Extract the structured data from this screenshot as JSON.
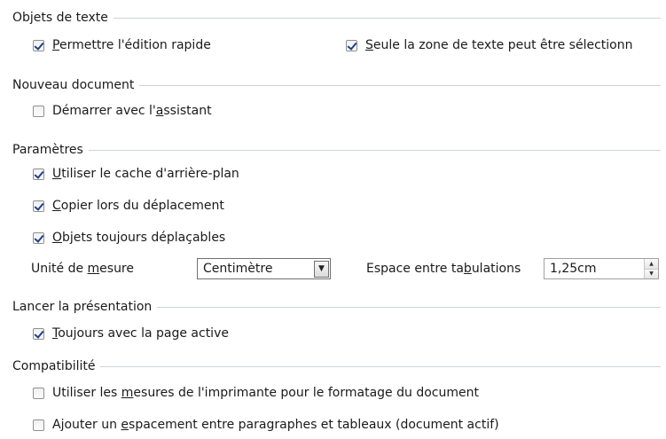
{
  "sections": {
    "text_objects": {
      "title": "Objets de texte",
      "quick_edit": {
        "pre": "",
        "u": "P",
        "post": "ermettre l'édition rapide",
        "checked": true
      },
      "text_area_only": {
        "pre": "",
        "u": "S",
        "post": "eule la zone de texte peut être sélectionn",
        "checked": true
      }
    },
    "new_document": {
      "title": "Nouveau document",
      "start_wizard": {
        "pre": "Démarrer avec l'",
        "u": "a",
        "post": "ssistant",
        "checked": false
      }
    },
    "settings": {
      "title": "Paramètres",
      "bg_cache": {
        "pre": "",
        "u": "U",
        "post": "tiliser le cache d'arrière-plan",
        "checked": true
      },
      "copy_on_move": {
        "pre": "",
        "u": "C",
        "post": "opier lors du déplacement",
        "checked": true
      },
      "objects_movable": {
        "pre": "",
        "u": "O",
        "post": "bjets toujours déplaçables",
        "checked": true
      },
      "unit_label": {
        "pre": "Unité de ",
        "u": "m",
        "post": "esure"
      },
      "unit_value": "Centimètre",
      "tab_label": {
        "pre": "Espace entre ta",
        "u": "b",
        "post": "ulations"
      },
      "tab_value": "1,25cm"
    },
    "presentation": {
      "title": "Lancer la présentation",
      "always_active_page": {
        "pre": "",
        "u": "T",
        "post": "oujours avec la page active",
        "checked": true
      }
    },
    "compat": {
      "title": "Compatibilité",
      "printer_metrics": {
        "pre": "Utiliser les ",
        "u": "m",
        "post": "esures de l'imprimante pour le formatage du document",
        "checked": false
      },
      "para_spacing": {
        "pre": "Ajouter un ",
        "u": "e",
        "post": "spacement entre paragraphes et tableaux (document actif)",
        "checked": false
      }
    }
  },
  "icons": {
    "dropdown": "chevron-down-icon",
    "spin_up": "spin-up-icon",
    "spin_down": "spin-down-icon"
  }
}
